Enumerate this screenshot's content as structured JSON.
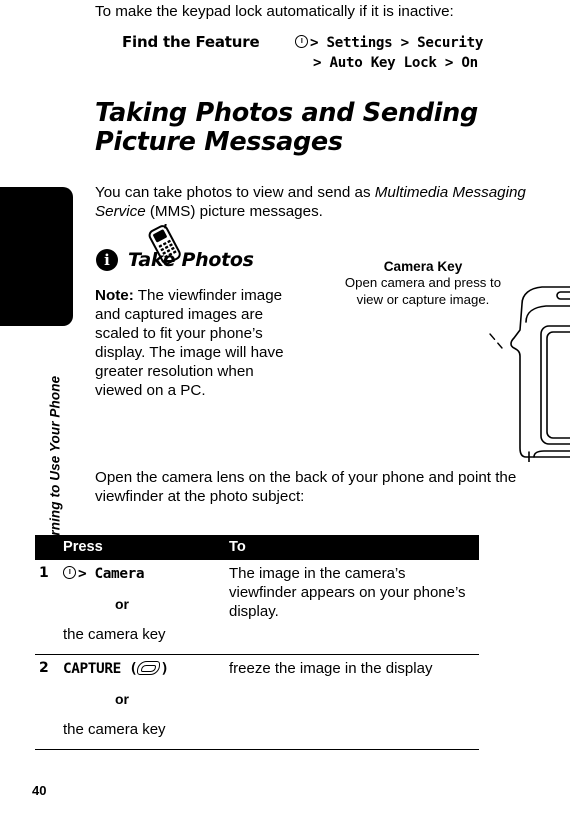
{
  "sidebar": {
    "chapter_label": "Learning to Use Your Phone",
    "page_number": "40",
    "tab_color": "#000000"
  },
  "intro": {
    "line": "To make the keypad lock automatically if it is inactive:"
  },
  "find_the_feature": {
    "label": "Find the Feature",
    "path_line_1": "> Settings > Security",
    "path_line_2": "> Auto Key Lock > On",
    "menu_key_icon": "menu-key-icon"
  },
  "heading": {
    "text": "Taking Photos and Sending Picture Messages"
  },
  "intro_paragraph": {
    "part_1": "You can take photos to view and send as ",
    "italic_1": "Multimedia Messaging Service",
    "part_2": " (MMS) picture messages."
  },
  "subhead": {
    "badge": "i",
    "badge_icon": "info-badge-icon",
    "phone_icon": "phone-illustration-icon",
    "text": "Take Photos"
  },
  "note_paragraph": {
    "label": "Note:",
    "text": " The viewfinder image and captured images are scaled to fit your phone’s display. The image will have greater resolution when viewed on a PC."
  },
  "open_paragraph": {
    "text": "Open the camera lens on the back of your phone and point the viewfinder at the photo subject:"
  },
  "callout": {
    "title": "Camera Key",
    "body": "Open camera and press to view or capture image."
  },
  "phone_art": {
    "brand_logo": "motorola-m-logo",
    "display_label": "phone-display"
  },
  "procedure_table": {
    "headers": {
      "num": "",
      "press": "Press",
      "to": "To"
    },
    "header_bg": "#000000",
    "rows": [
      {
        "num": "1",
        "press_cmd": "> Camera",
        "press_has_menu_key": true,
        "press_or": "or",
        "press_alt": "the camera key",
        "to": "The image in the camera’s viewfinder appears on your phone’s display."
      },
      {
        "num": "2",
        "press_cmd": "CAPTURE",
        "press_has_menu_key": false,
        "press_or": "or",
        "press_alt": "the camera key",
        "to": "freeze the image in the display"
      }
    ]
  }
}
